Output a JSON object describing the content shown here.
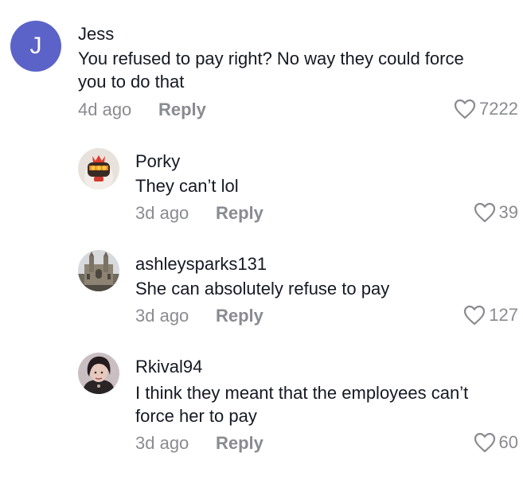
{
  "comments": [
    {
      "avatar_letter": "J",
      "username": "Jess",
      "text_line1": "You refused to pay right? No way they could force",
      "text_line2": "you to do that",
      "time": "4d ago",
      "reply_label": "Reply",
      "likes": "7222"
    },
    {
      "username": "Porky",
      "text_line1": "They can’t lol",
      "time": "3d ago",
      "reply_label": "Reply",
      "likes": "39"
    },
    {
      "username": "ashleysparks131",
      "text_line1": "She can absolutely refuse to pay",
      "time": "3d ago",
      "reply_label": "Reply",
      "likes": "127"
    },
    {
      "username": "Rkival94",
      "text_line1": "I think they meant that the employees can’t",
      "text_line2": "force her to pay",
      "time": "3d ago",
      "reply_label": "Reply",
      "likes": "60"
    }
  ],
  "colors": {
    "letter_avatar_bg": "#5b63c8",
    "muted_text": "#8a8b91",
    "primary_text": "#161823"
  },
  "icons": {
    "like": "heart-outline-icon"
  }
}
